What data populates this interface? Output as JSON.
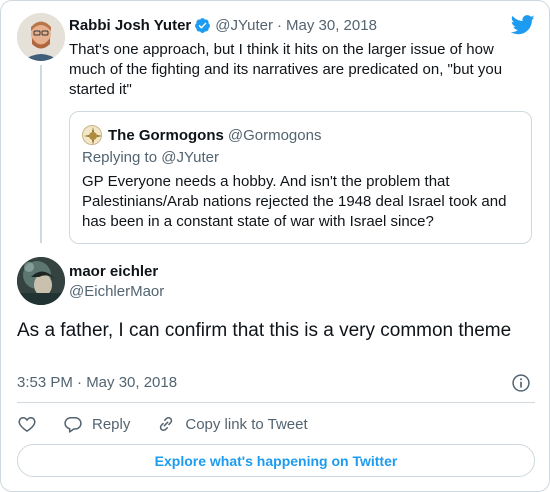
{
  "colors": {
    "accent": "#1d9bf0",
    "secondary_text": "#536471",
    "border": "#cfd9de"
  },
  "parent_tweet": {
    "name": "Rabbi Josh Yuter",
    "handle": "@JYuter",
    "separator": "·",
    "date": "May 30, 2018",
    "verified_icon": "verified-badge-icon",
    "text": "That's one approach, but I think it hits on the larger issue of how much of the fighting and its narratives are predicated on, \"but you started it\""
  },
  "quoted_tweet": {
    "name": "The Gormogons",
    "handle": "@Gormogons",
    "replying_to": "Replying to @JYuter",
    "text": "GP Everyone needs a hobby. And isn't the problem that Palestinians/Arab nations rejected the 1948 deal Israel took and has been in a constant state of war with Israel since?"
  },
  "main_tweet": {
    "name": "maor eichler",
    "handle": "@EichlerMaor",
    "text": "As a father, I can confirm that this is a very common theme",
    "timestamp": "3:53 PM · May 30, 2018"
  },
  "actions": {
    "like_icon": "heart-icon",
    "reply_label": "Reply",
    "reply_icon": "reply-icon",
    "copy_label": "Copy link to Tweet",
    "copy_icon": "link-icon"
  },
  "explore_label": "Explore what's happening on Twitter",
  "brand_icon": "twitter-bird-icon"
}
